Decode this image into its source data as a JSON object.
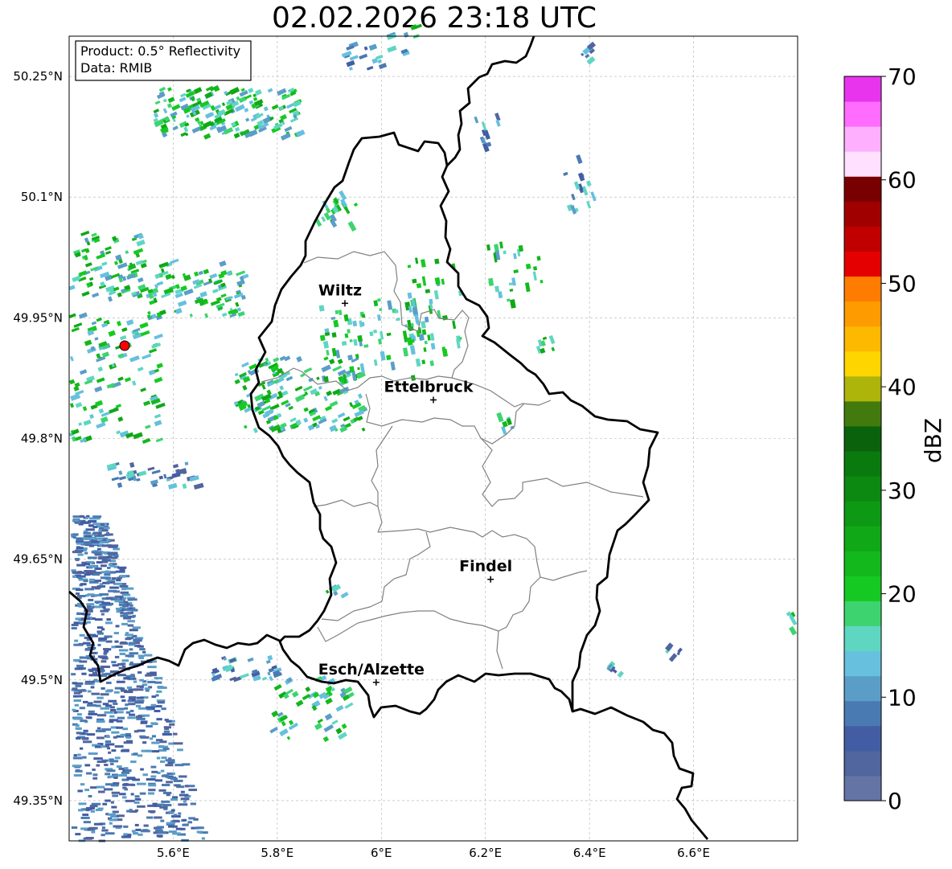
{
  "title": "02.02.2026 23:18 UTC",
  "info_box": {
    "product": "Product: 0.5° Reflectivity",
    "data": "Data: RMIB"
  },
  "radar_site_color": "#ff0000",
  "axes": {
    "x_ticks": [
      "5.6°E",
      "5.8°E",
      "6°E",
      "6.2°E",
      "6.4°E",
      "6.6°E"
    ],
    "x_tick_values": [
      5.6,
      5.8,
      6.0,
      6.2,
      6.4,
      6.6
    ],
    "y_ticks": [
      "50.25°N",
      "50.1°N",
      "49.95°N",
      "49.8°N",
      "49.65°N",
      "49.5°N",
      "49.35°N"
    ],
    "y_tick_values": [
      50.25,
      50.1,
      49.95,
      49.8,
      49.65,
      49.5,
      49.35
    ],
    "lon_range": [
      5.4,
      6.8
    ],
    "lat_range": [
      49.3,
      50.3
    ],
    "grid": true
  },
  "cities": [
    {
      "name": "Wiltz",
      "lon": 5.93,
      "lat": 49.968
    },
    {
      "name": "Ettelbruck",
      "lon": 6.1,
      "lat": 49.848
    },
    {
      "name": "Findel",
      "lon": 6.21,
      "lat": 49.625
    },
    {
      "name": "Esch/Alzette",
      "lon": 5.99,
      "lat": 49.497
    }
  ],
  "colorbar": {
    "label": "dBZ",
    "ticks": [
      "0",
      "10",
      "20",
      "30",
      "40",
      "50",
      "60",
      "70"
    ],
    "min": 0,
    "max": 70,
    "colors": [
      "#6475a5",
      "#51659e",
      "#425da3",
      "#4a7ab2",
      "#5a9ec8",
      "#66c0de",
      "#5fd6c2",
      "#3dd46f",
      "#16c922",
      "#13b81c",
      "#10a817",
      "#0d9914",
      "#0c8911",
      "#0a7a0e",
      "#0b620d",
      "#437a0d",
      "#adb40a",
      "#ffd500",
      "#fdb900",
      "#fd9b00",
      "#fe7c00",
      "#e40000",
      "#c00000",
      "#a10000",
      "#790000",
      "#ffe0ff",
      "#feb0fe",
      "#ff6cfe",
      "#e834ed"
    ]
  }
}
